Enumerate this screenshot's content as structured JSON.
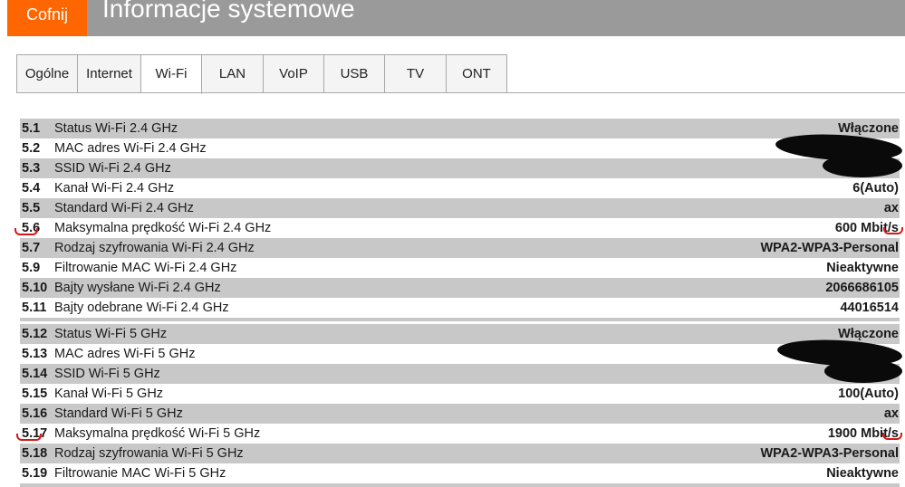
{
  "header": {
    "back_label": "Cofnij",
    "title": "Informacje systemowe",
    "brand_color": "#ff6600"
  },
  "tabs": [
    {
      "label": "Ogólne"
    },
    {
      "label": "Internet"
    },
    {
      "label": "Wi-Fi",
      "active": true
    },
    {
      "label": "LAN"
    },
    {
      "label": "VoIP"
    },
    {
      "label": "USB"
    },
    {
      "label": "TV"
    },
    {
      "label": "ONT"
    }
  ],
  "wifi24": [
    {
      "num": "5.1",
      "label": "Status Wi-Fi 2.4 GHz",
      "value": "Włączone"
    },
    {
      "num": "5.2",
      "label": "MAC adres Wi-Fi 2.4 GHz",
      "value": ""
    },
    {
      "num": "5.3",
      "label": "SSID Wi-Fi 2.4 GHz",
      "value": ""
    },
    {
      "num": "5.4",
      "label": "Kanał Wi-Fi 2.4 GHz",
      "value": "6(Auto)"
    },
    {
      "num": "5.5",
      "label": "Standard Wi-Fi 2.4 GHz",
      "value": "ax"
    },
    {
      "num": "5.6",
      "label": "Maksymalna prędkość Wi-Fi 2.4 GHz",
      "value": "600 Mbit/s"
    },
    {
      "num": "5.7",
      "label": "Rodzaj szyfrowania Wi-Fi 2.4 GHz",
      "value": "WPA2-WPA3-Personal"
    },
    {
      "num": "5.9",
      "label": "Filtrowanie MAC Wi-Fi 2.4 GHz",
      "value": "Nieaktywne"
    },
    {
      "num": "5.10",
      "label": "Bajty wysłane Wi-Fi 2.4 GHz",
      "value": "2066686105"
    },
    {
      "num": "5.11",
      "label": "Bajty odebrane Wi-Fi 2.4 GHz",
      "value": "44016514"
    }
  ],
  "wifi5": [
    {
      "num": "5.12",
      "label": "Status Wi-Fi 5 GHz",
      "value": "Włączone"
    },
    {
      "num": "5.13",
      "label": "MAC adres Wi-Fi 5 GHz",
      "value": ""
    },
    {
      "num": "5.14",
      "label": "SSID Wi-Fi 5 GHz",
      "value": ""
    },
    {
      "num": "5.15",
      "label": "Kanał Wi-Fi 5 GHz",
      "value": "100(Auto)"
    },
    {
      "num": "5.16",
      "label": "Standard Wi-Fi 5 GHz",
      "value": "ax"
    },
    {
      "num": "5.17",
      "label": "Maksymalna prędkość Wi-Fi 5 GHz",
      "value": "1900 Mbit/s"
    },
    {
      "num": "5.18",
      "label": "Rodzaj szyfrowania Wi-Fi 5 GHz",
      "value": "WPA2-WPA3-Personal"
    },
    {
      "num": "5.19",
      "label": "Filtrowanie MAC Wi-Fi 5 GHz",
      "value": "Nieaktywne"
    }
  ],
  "annotation_color": "#d41818",
  "redaction_color": "#0a0a0a"
}
